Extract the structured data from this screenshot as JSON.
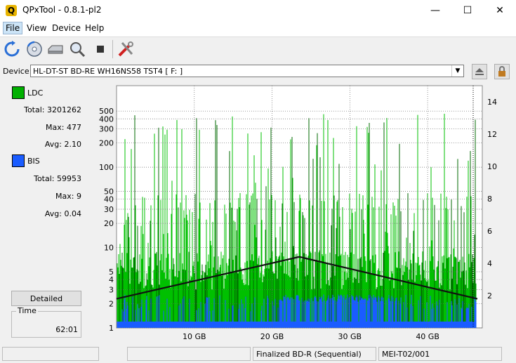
{
  "window": {
    "title": "QPxTool - 0.8.1-pl2",
    "app_icon_glyph": "Q",
    "minimize": "—",
    "maximize": "☐",
    "close": "✕"
  },
  "menu": {
    "items": [
      "File",
      "View",
      "Device",
      "Help"
    ]
  },
  "toolbar": {
    "icons": [
      "refresh-icon",
      "disc-scan-icon",
      "drive-icon",
      "zoom-icon",
      "stop-icon",
      "tools-icon"
    ]
  },
  "device": {
    "label": "Device:",
    "value": "HL-DT-ST BD-RE  WH16NS58  TST4 [ F: ]",
    "eject_icon": "eject-icon",
    "lock_icon": "lock-icon"
  },
  "stats": {
    "ldc": {
      "label": "LDC",
      "color": "#00b000",
      "total_label": "Total:",
      "total": "3201262",
      "max_label": "Max:",
      "max": "477",
      "avg_label": "Avg:",
      "avg": "2.10"
    },
    "bis": {
      "label": "BIS",
      "color": "#1a5cff",
      "total_label": "Total:",
      "total": "59953",
      "max_label": "Max:",
      "max": "9",
      "avg_label": "Avg:",
      "avg": "0.04"
    }
  },
  "detailed_button": "Detailed",
  "time": {
    "label": "Time",
    "value": "62:01"
  },
  "status": {
    "cell1": "",
    "cell2": "",
    "disc_type": "Finalized BD-R (Sequential)",
    "media_id": "MEI-T02/001"
  },
  "chart_data": {
    "type": "area",
    "y_left_scale": "log",
    "y_left_ticks": [
      "1",
      "2",
      "3",
      "4",
      "5",
      "10",
      "20",
      "30",
      "40",
      "50",
      "100",
      "200",
      "300",
      "400",
      "500"
    ],
    "y_right_ticks": [
      "2",
      "4",
      "6",
      "8",
      "10",
      "12",
      "14"
    ],
    "x_ticks": [
      "10 GB",
      "20 GB",
      "30 GB",
      "40 GB"
    ],
    "x_tick_values": [
      10,
      20,
      30,
      40
    ],
    "xlim": [
      0,
      46.4
    ],
    "ylim_right": [
      0,
      15
    ],
    "grid": true,
    "series": [
      {
        "color": "#00c000",
        "approx_base": 5,
        "approx_peak": 477
      },
      {
        "color": "#1a5cff",
        "approx_base": 1,
        "approx_peak": 9
      },
      {
        "color": "#000000",
        "x": [
          0,
          23.5,
          46.4
        ],
        "y": [
          1.8,
          4.4,
          1.8
        ]
      }
    ]
  }
}
